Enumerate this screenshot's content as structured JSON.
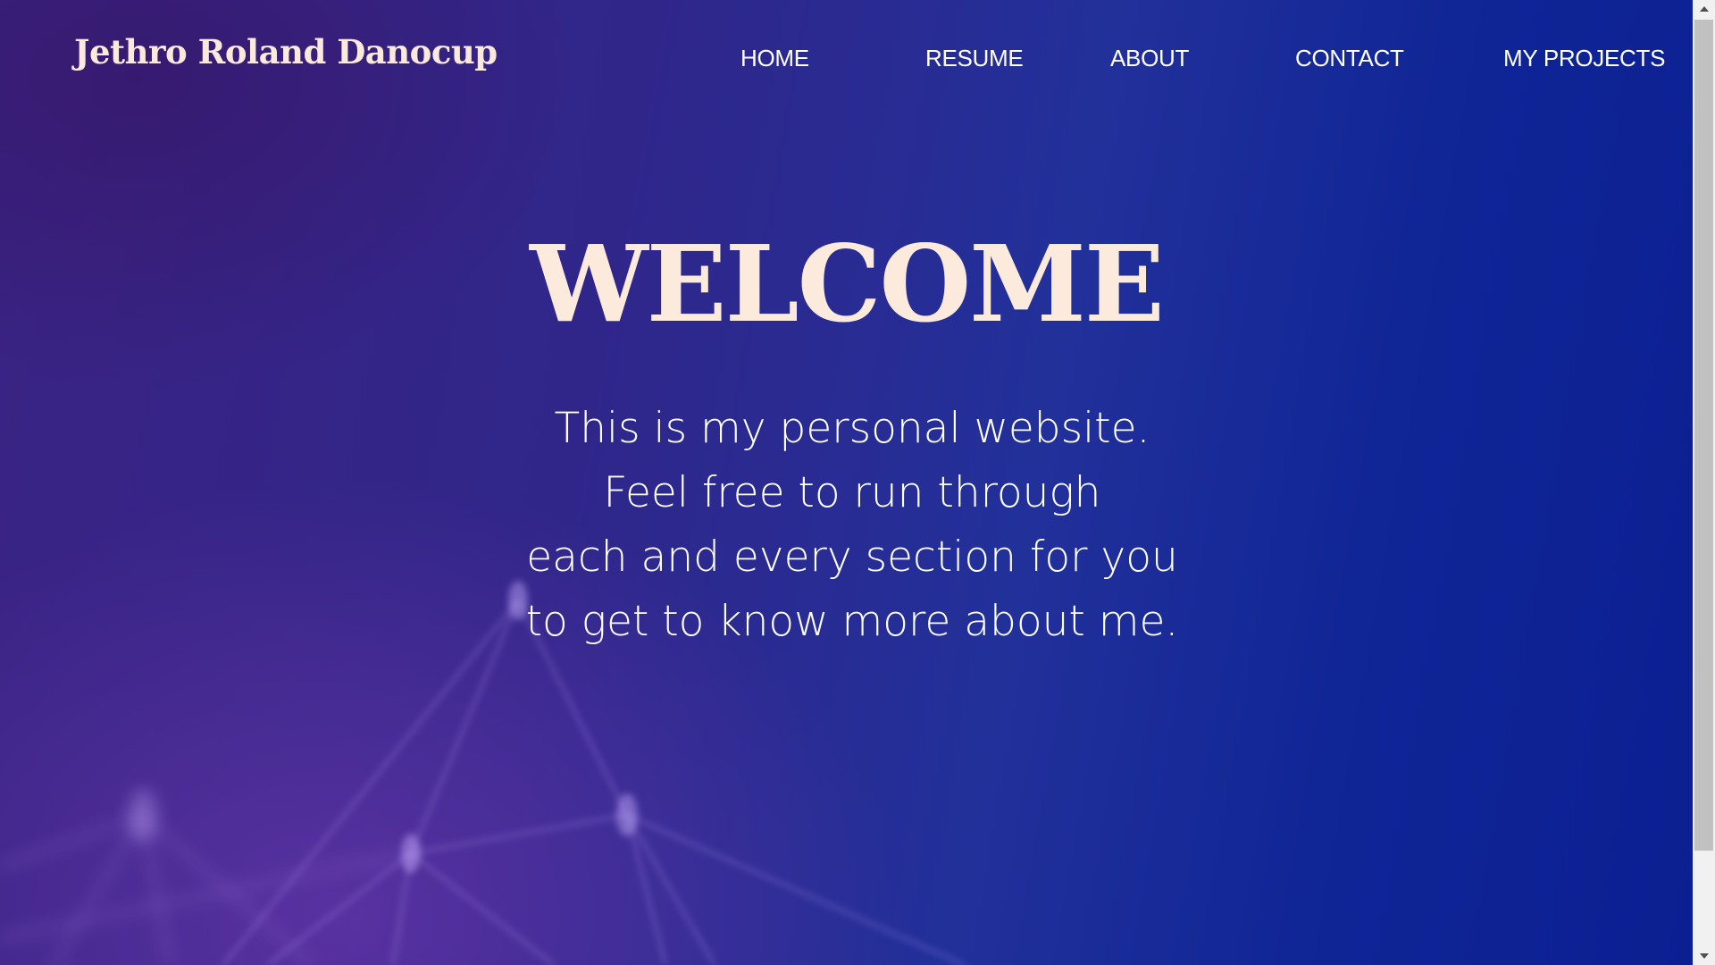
{
  "header": {
    "brand": "Jethro Roland Danocup",
    "nav": {
      "home": "HOME",
      "resume": "RESUME",
      "about": "ABOUT",
      "contact": "CONTACT",
      "projects": "MY PROJECTS"
    }
  },
  "hero": {
    "title": "WELCOME",
    "intro_lines": [
      "This is my personal website.",
      "Feel free to run through",
      "each and every section for you",
      "to get to know more about me."
    ]
  },
  "colors": {
    "brand_text": "#fbe9dc",
    "title_text": "#fcebdd",
    "nav_text": "#ffffff",
    "bg_purple": "#3a2383",
    "bg_blue": "#0c1f92"
  },
  "icons": {
    "scroll_up": "triangle-up-icon",
    "scroll_down": "triangle-down-icon",
    "background": "network-graph-graphic"
  }
}
